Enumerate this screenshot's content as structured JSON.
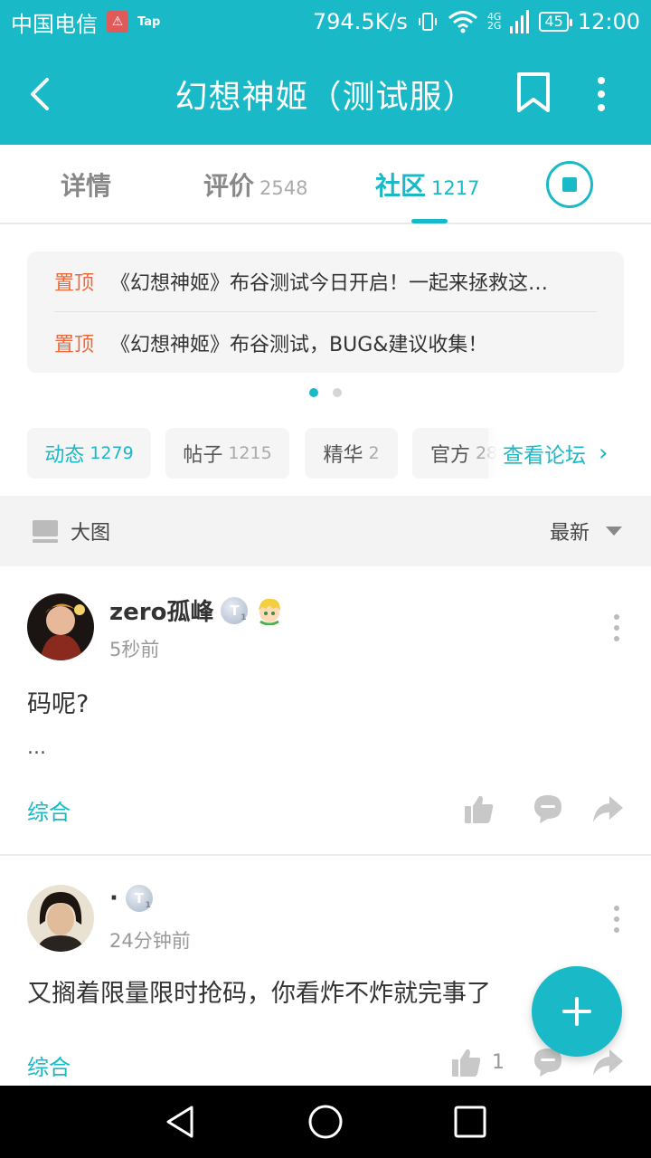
{
  "status_bar": {
    "carrier": "中国电信",
    "tap_label": "Tap",
    "net_speed": "794.5K/s",
    "net_type_top": "4G",
    "net_type_bottom": "2G",
    "battery": "45",
    "time": "12:00"
  },
  "app_bar": {
    "title": "幻想神姬（测试服）"
  },
  "tabs": [
    {
      "label": "详情",
      "count": ""
    },
    {
      "label": "评价",
      "count": "2548"
    },
    {
      "label": "社区",
      "count": "1217"
    }
  ],
  "pinned": [
    {
      "tag": "置顶",
      "text": "《幻想神姬》布谷测试今日开启！一起来拯救这…"
    },
    {
      "tag": "置顶",
      "text": "《幻想神姬》布谷测试，BUG&建议收集！"
    }
  ],
  "chips": [
    {
      "label": "动态",
      "count": "1279"
    },
    {
      "label": "帖子",
      "count": "1215"
    },
    {
      "label": "精华",
      "count": "2"
    },
    {
      "label": "官方",
      "count": "28"
    }
  ],
  "view_forum": "查看论坛",
  "sort_bar": {
    "view_label": "大图",
    "sort_label": "最新"
  },
  "posts": [
    {
      "username": "zero孤峰",
      "time": "5秒前",
      "body": "码呢?",
      "ellipsis": "...",
      "category": "综合",
      "likes": ""
    },
    {
      "username": "·",
      "time": "24分钟前",
      "body": "又搁着限量限时抢码，你看炸不炸就完事了",
      "category": "综合",
      "likes": "1"
    }
  ],
  "badge_letter": "T",
  "badge_level": "1",
  "colors": {
    "accent": "#19b9c8",
    "pin_tag": "#ea6a3e"
  }
}
